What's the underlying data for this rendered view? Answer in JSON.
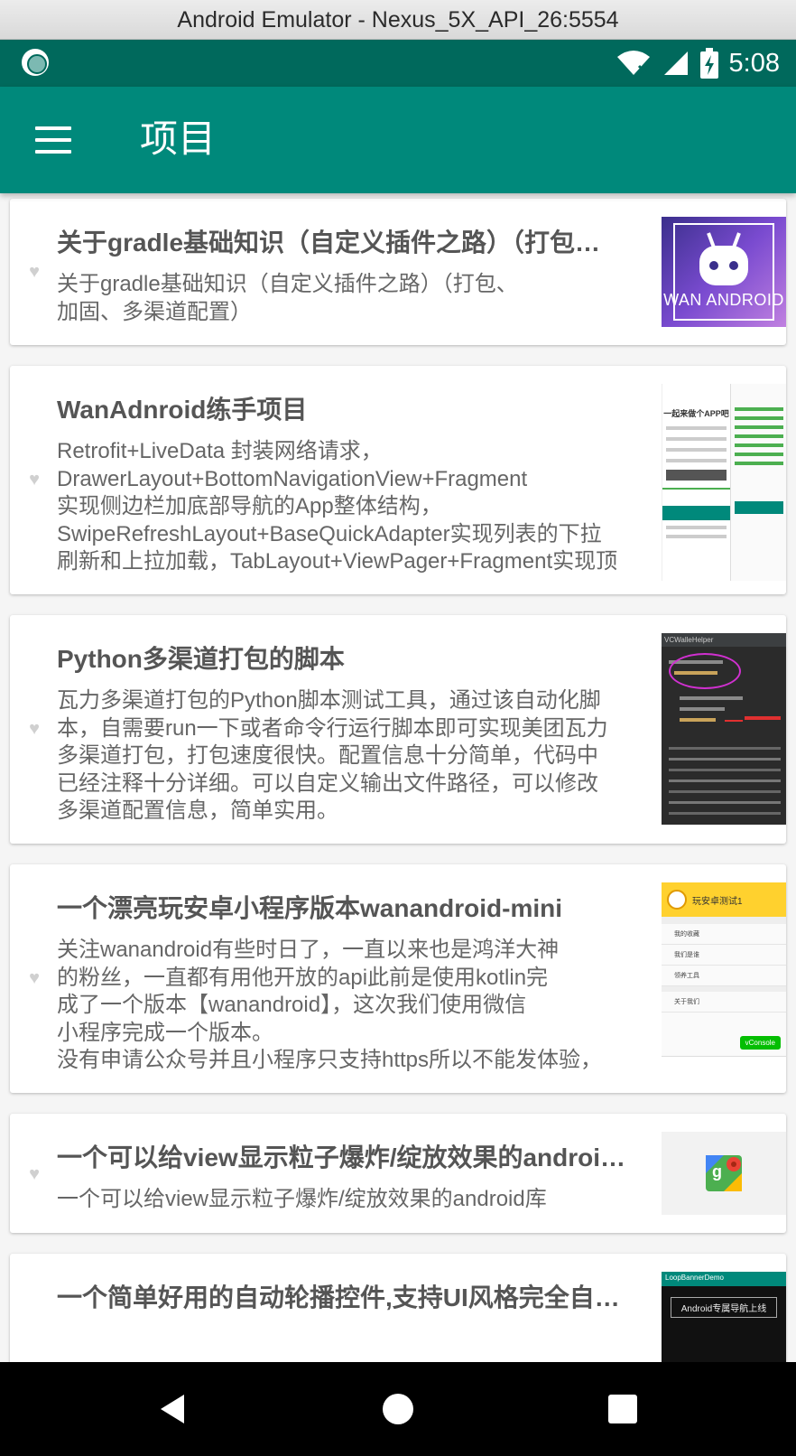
{
  "window": {
    "title": "Android Emulator - Nexus_5X_API_26:5554"
  },
  "status_bar": {
    "time": "5:08"
  },
  "toolbar": {
    "title": "项目",
    "menu_icon": "hamburger-menu-icon"
  },
  "colors": {
    "primary": "#00897b",
    "primary_dark": "#00695c",
    "heart": "#d0d0d0"
  },
  "projects": [
    {
      "title": "关于gradle基础知识（自定义插件之路）（打包…",
      "desc": "关于gradle基础知识（自定义插件之路）（打包、\n加固、多渠道配置）",
      "thumb": {
        "text": "WAN ANDROID"
      }
    },
    {
      "title": "WanAdnroid练手项目",
      "desc": "Retrofit+LiveData 封装网络请求，\nDrawerLayout+BottomNavigationView+Fragment\n实现侧边栏加底部导航的App整体结构，\nSwipeRefreshLayout+BaseQuickAdapter实现列表的下拉\n刷新和上拉加载，TabLayout+ViewPager+Fragment实现顶",
      "thumb": {
        "text": "一起来做个APP吧"
      }
    },
    {
      "title": "Python多渠道打包的脚本",
      "desc": "瓦力多渠道打包的Python脚本测试工具，通过该自动化脚\n本，自需要run一下或者命令行运行脚本即可实现美团瓦力\n多渠道打包，打包速度很快。配置信息十分简单，代码中\n已经注释十分详细。可以自定义输出文件路径，可以修改\n多渠道配置信息，简单实用。",
      "thumb": {
        "text": "VCWalleHelper"
      }
    },
    {
      "title": "一个漂亮玩安卓小程序版本wanandroid-mini",
      "desc": "关注wanandroid有些时日了，一直以来也是鸿洋大神\n的粉丝，一直都有用他开放的api此前是使用kotlin完\n成了一个版本【wanandroid】，这次我们使用微信\n小程序完成一个版本。\n没有申请公众号并且小程序只支持https所以不能发体验，",
      "thumb": {
        "header": "玩安卓测试1",
        "rows": [
          "我的收藏",
          "我们是谁",
          "领养工具",
          "关于我们"
        ],
        "button": "vConsole"
      }
    },
    {
      "title": "一个可以给view显示粒子爆炸/绽放效果的androi…",
      "desc": "一个可以给view显示粒子爆炸/绽放效果的android库",
      "thumb": {
        "text": "maps"
      }
    },
    {
      "title": "一个简单好用的自动轮播控件,支持UI风格完全自…",
      "desc": "",
      "thumb": {
        "header": "LoopBannerDemo",
        "text": "Android专属导航上线"
      }
    }
  ]
}
